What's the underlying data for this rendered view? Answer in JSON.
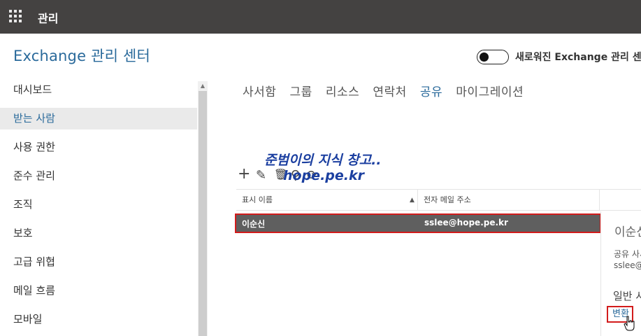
{
  "topbar": {
    "title": "관리",
    "waffle_icon": "waffle-icon"
  },
  "app": {
    "title": "Exchange 관리 센터"
  },
  "toggle": {
    "label": "새로워진 Exchange 관리 센"
  },
  "sidebar": {
    "items": [
      {
        "label": "대시보드",
        "selected": false
      },
      {
        "label": "받는 사람",
        "selected": true
      },
      {
        "label": "사용 권한",
        "selected": false
      },
      {
        "label": "준수 관리",
        "selected": false
      },
      {
        "label": "조직",
        "selected": false
      },
      {
        "label": "보호",
        "selected": false
      },
      {
        "label": "고급 위협",
        "selected": false
      },
      {
        "label": "메일 흐름",
        "selected": false
      },
      {
        "label": "모바일",
        "selected": false
      }
    ]
  },
  "tabs": [
    {
      "label": "사서함",
      "active": false
    },
    {
      "label": "그룹",
      "active": false
    },
    {
      "label": "리소스",
      "active": false
    },
    {
      "label": "연락처",
      "active": false
    },
    {
      "label": "공유",
      "active": true
    },
    {
      "label": "마이그레이션",
      "active": false
    }
  ],
  "watermark": {
    "line1": "준범이의 지식 창고..",
    "line2": "hope.pe.kr"
  },
  "toolbar": {
    "add": "+",
    "edit": "✎",
    "delete": "🗑",
    "search": "⚲",
    "refresh": "⟳"
  },
  "table": {
    "headers": [
      "표시 이름",
      "전자 메일 주소"
    ],
    "rows": [
      {
        "name": "이순신",
        "email": "sslee@hope.pe.kr"
      }
    ]
  },
  "detail": {
    "name": "이순신",
    "type": "공유 사서함",
    "email": "sslee@hope.pe.kr",
    "section": "일반 사서함",
    "change_label": "변환"
  }
}
